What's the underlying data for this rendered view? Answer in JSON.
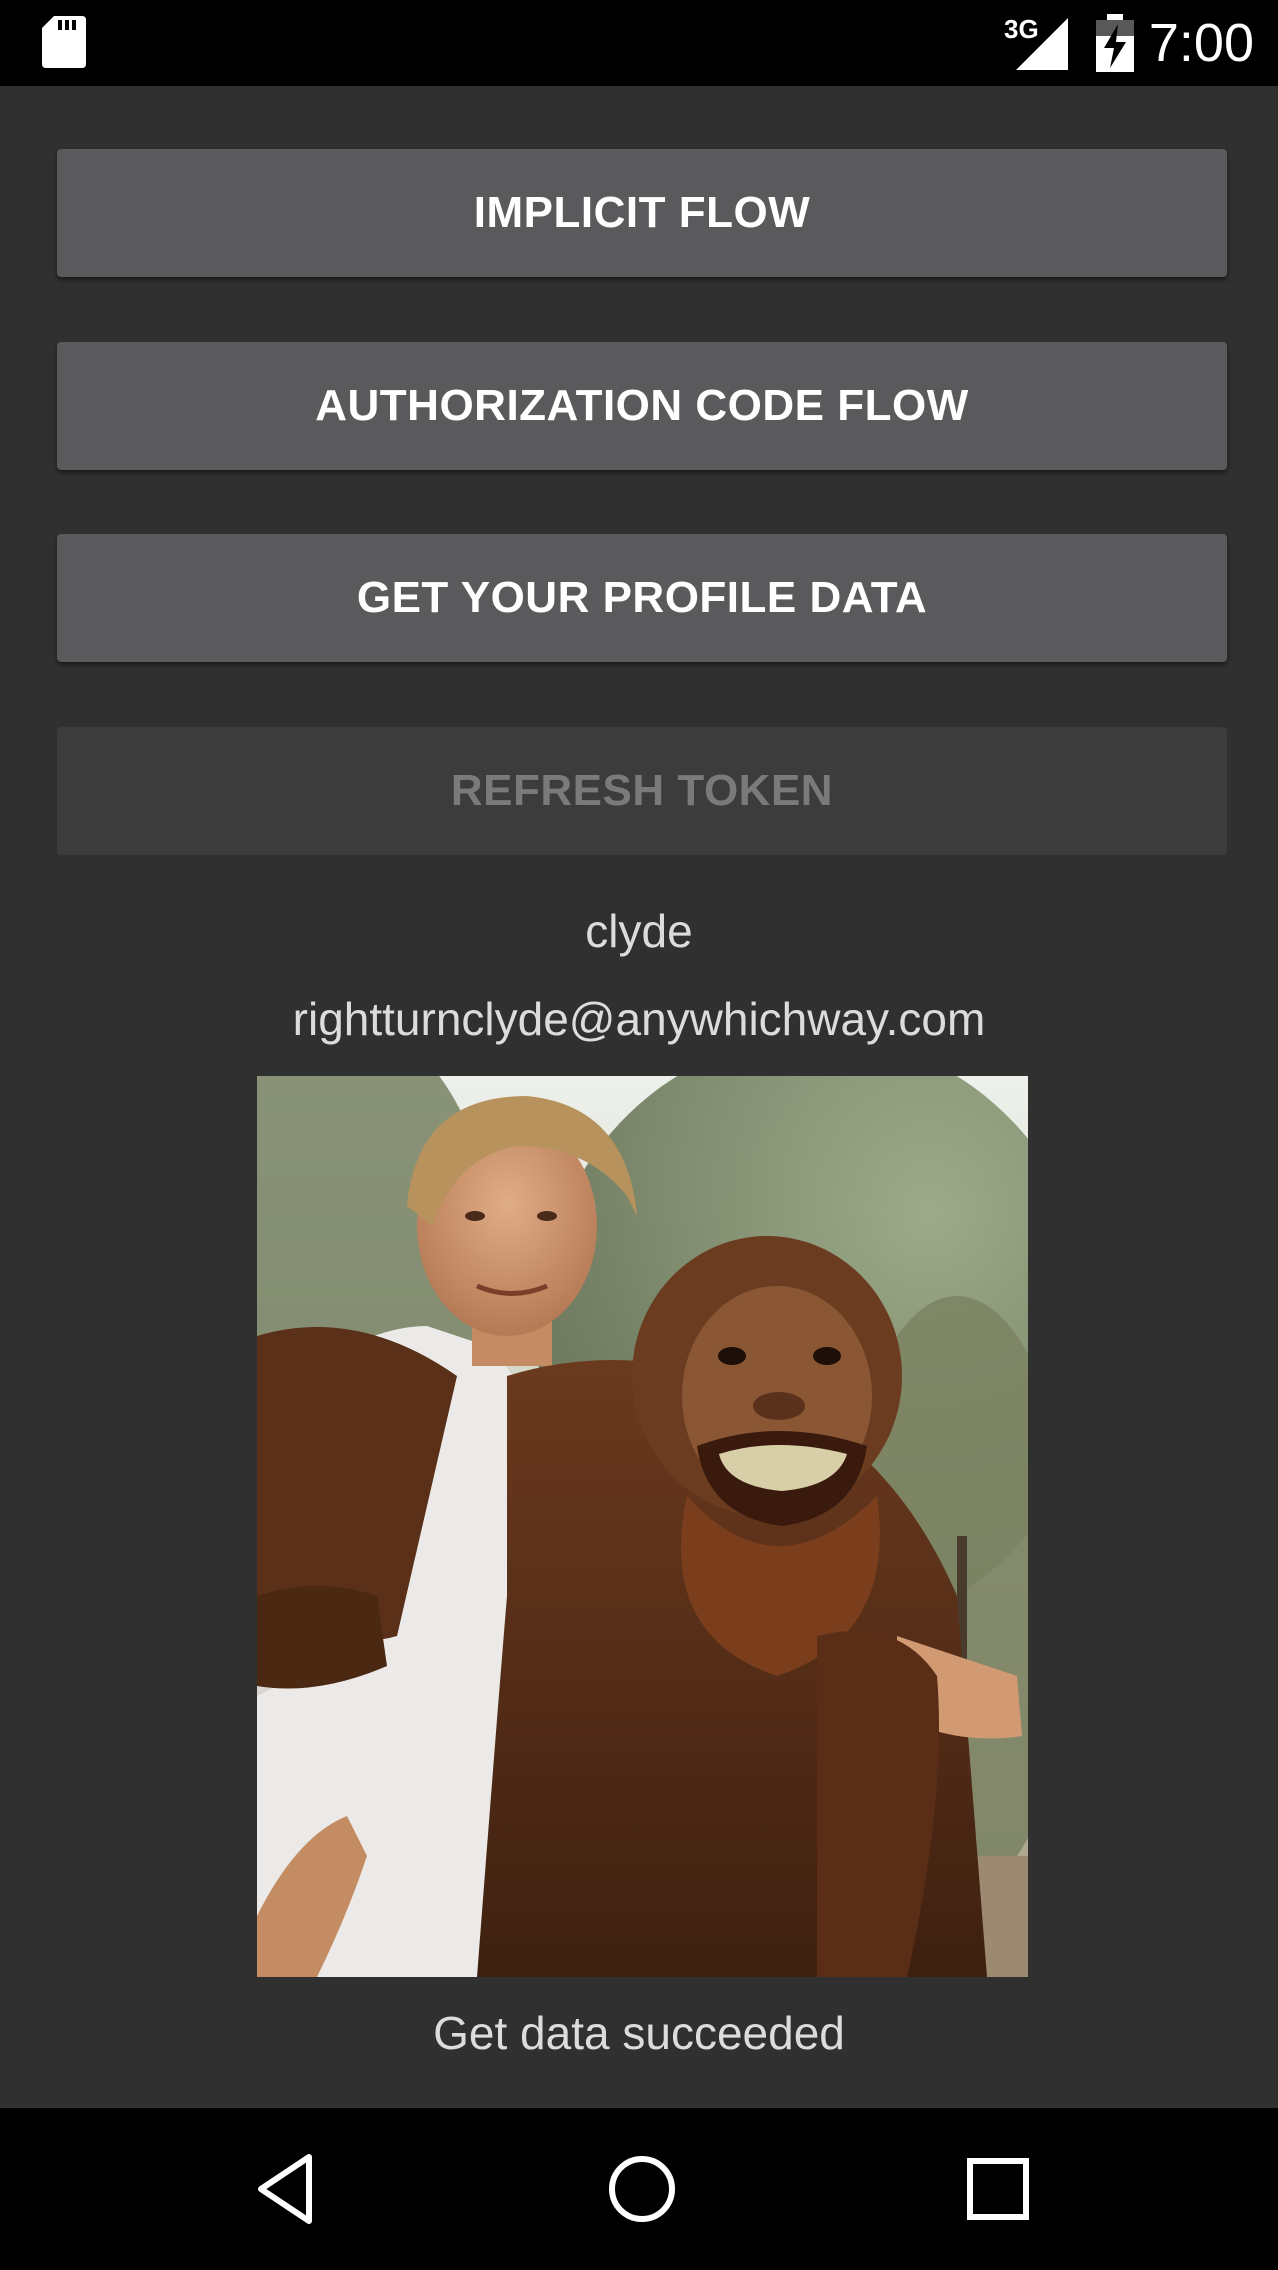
{
  "status_bar": {
    "network": "3G",
    "time": "7:00"
  },
  "buttons": {
    "implicit_flow": "IMPLICIT FLOW",
    "authorization_code_flow": "AUTHORIZATION CODE FLOW",
    "get_profile_data": "GET YOUR PROFILE DATA",
    "refresh_token": "REFRESH TOKEN"
  },
  "profile": {
    "username": "clyde",
    "email": "rightturnclyde@anywhichway.com"
  },
  "status_message": "Get data succeeded",
  "icons": {
    "sd_card": "sd-card-icon",
    "signal": "signal-icon",
    "battery": "battery-charging-icon",
    "back": "back-icon",
    "home": "home-icon",
    "recents": "recents-icon"
  },
  "colors": {
    "background": "#303030",
    "button": "#5a5a5c",
    "button_disabled": "#3c3c3d",
    "text": "#dcdcdc"
  }
}
